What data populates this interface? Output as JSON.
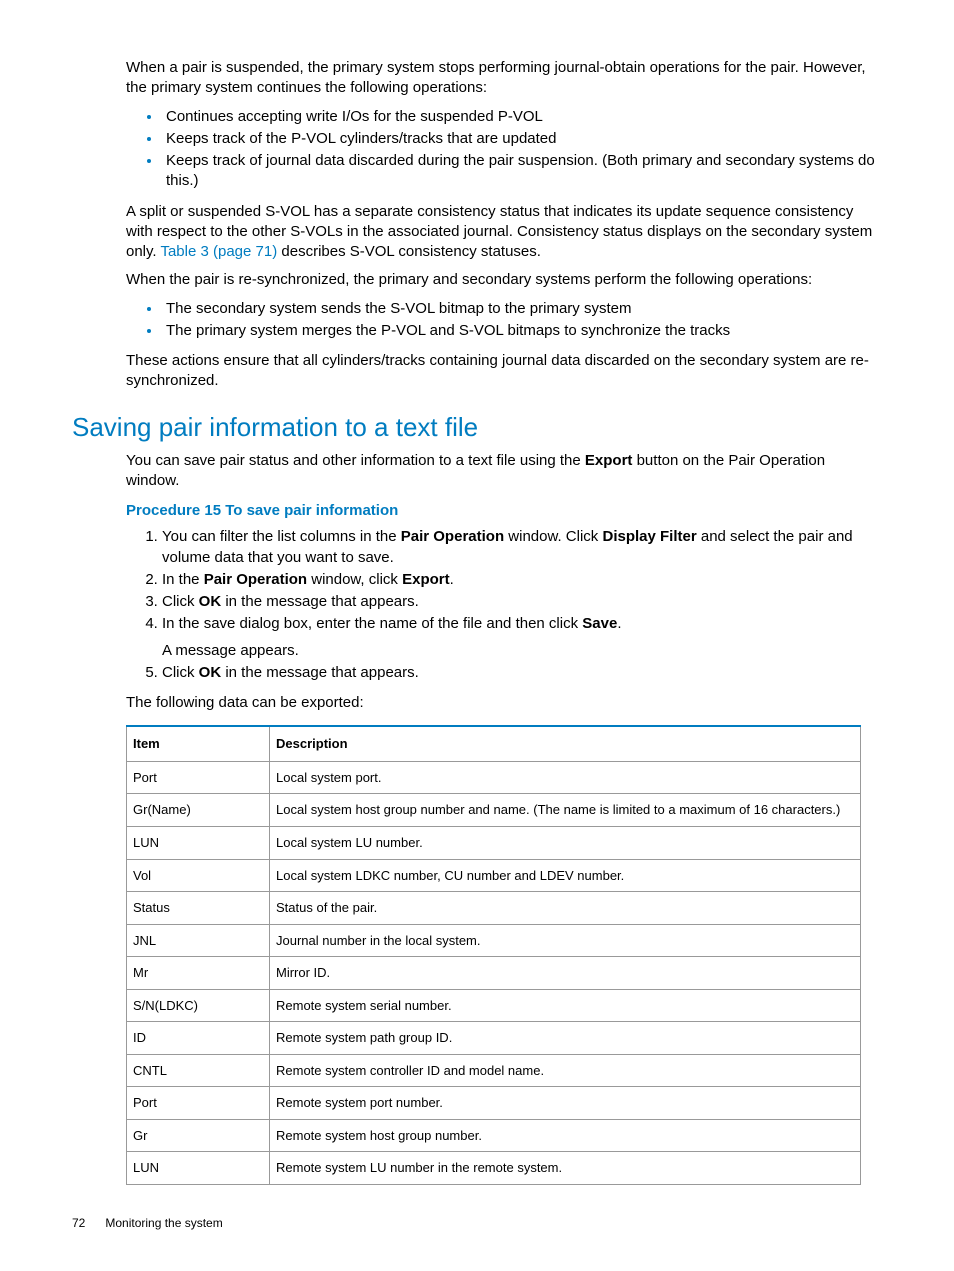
{
  "intro": {
    "p1": "When a pair is suspended, the primary system stops performing journal-obtain operations for the pair. However, the primary system continues the following operations:",
    "bullets1": [
      "Continues accepting write I/Os for the suspended P-VOL",
      "Keeps track of the P-VOL cylinders/tracks that are updated",
      "Keeps track of journal data discarded during the pair suspension. (Both primary and secondary systems do this.)"
    ],
    "p2_a": "A split or suspended S-VOL has a separate consistency status that indicates its update sequence consistency with respect to the other S-VOLs in the associated journal. Consistency status displays on the secondary system only. ",
    "p2_link": "Table 3 (page 71)",
    "p2_b": " describes S-VOL consistency statuses.",
    "p3": "When the pair is re-synchronized, the primary and secondary systems perform the following operations:",
    "bullets2": [
      "The secondary system sends the S-VOL bitmap to the primary system",
      "The primary system merges the P-VOL and S-VOL bitmaps to synchronize the tracks"
    ],
    "p4": "These actions ensure that all cylinders/tracks containing journal data discarded on the secondary system are re-synchronized."
  },
  "section": {
    "title": "Saving pair information to a text file",
    "p1_a": "You can save pair status and other information to a text file using the ",
    "p1_b": "Export",
    "p1_c": " button on the Pair Operation window.",
    "proc_title": "Procedure 15 To save pair information",
    "steps": {
      "s1_a": "You can filter the list columns in the ",
      "s1_b": "Pair Operation",
      "s1_c": " window. Click ",
      "s1_d": "Display Filter",
      "s1_e": " and select the pair and volume data that you want to save.",
      "s2_a": "In the ",
      "s2_b": "Pair Operation",
      "s2_c": " window, click ",
      "s2_d": "Export",
      "s2_e": ".",
      "s3_a": "Click ",
      "s3_b": "OK",
      "s3_c": " in the message that appears.",
      "s4_a": "In the save dialog box, enter the name of the file and then click ",
      "s4_b": "Save",
      "s4_c": ".",
      "s4_sub": "A message appears.",
      "s5_a": "Click ",
      "s5_b": "OK",
      "s5_c": " in the message that appears."
    },
    "p2": "The following data can be exported:"
  },
  "table": {
    "h1": "Item",
    "h2": "Description",
    "rows": [
      {
        "i": "Port",
        "d": "Local system port."
      },
      {
        "i": "Gr(Name)",
        "d": "Local system host group number and name. (The name is limited to a maximum of 16 characters.)"
      },
      {
        "i": "LUN",
        "d": "Local system LU number."
      },
      {
        "i": "Vol",
        "d": "Local system LDKC number, CU number and LDEV number."
      },
      {
        "i": "Status",
        "d": "Status of the pair."
      },
      {
        "i": "JNL",
        "d": "Journal number in the local system."
      },
      {
        "i": "Mr",
        "d": "Mirror ID."
      },
      {
        "i": "S/N(LDKC)",
        "d": "Remote system serial number."
      },
      {
        "i": "ID",
        "d": "Remote system path group ID."
      },
      {
        "i": "CNTL",
        "d": "Remote system controller ID and model name."
      },
      {
        "i": "Port",
        "d": "Remote system port number."
      },
      {
        "i": "Gr",
        "d": "Remote system host group number."
      },
      {
        "i": "LUN",
        "d": "Remote system LU number in the remote system."
      }
    ]
  },
  "footer": {
    "page": "72",
    "title": "Monitoring the system"
  }
}
